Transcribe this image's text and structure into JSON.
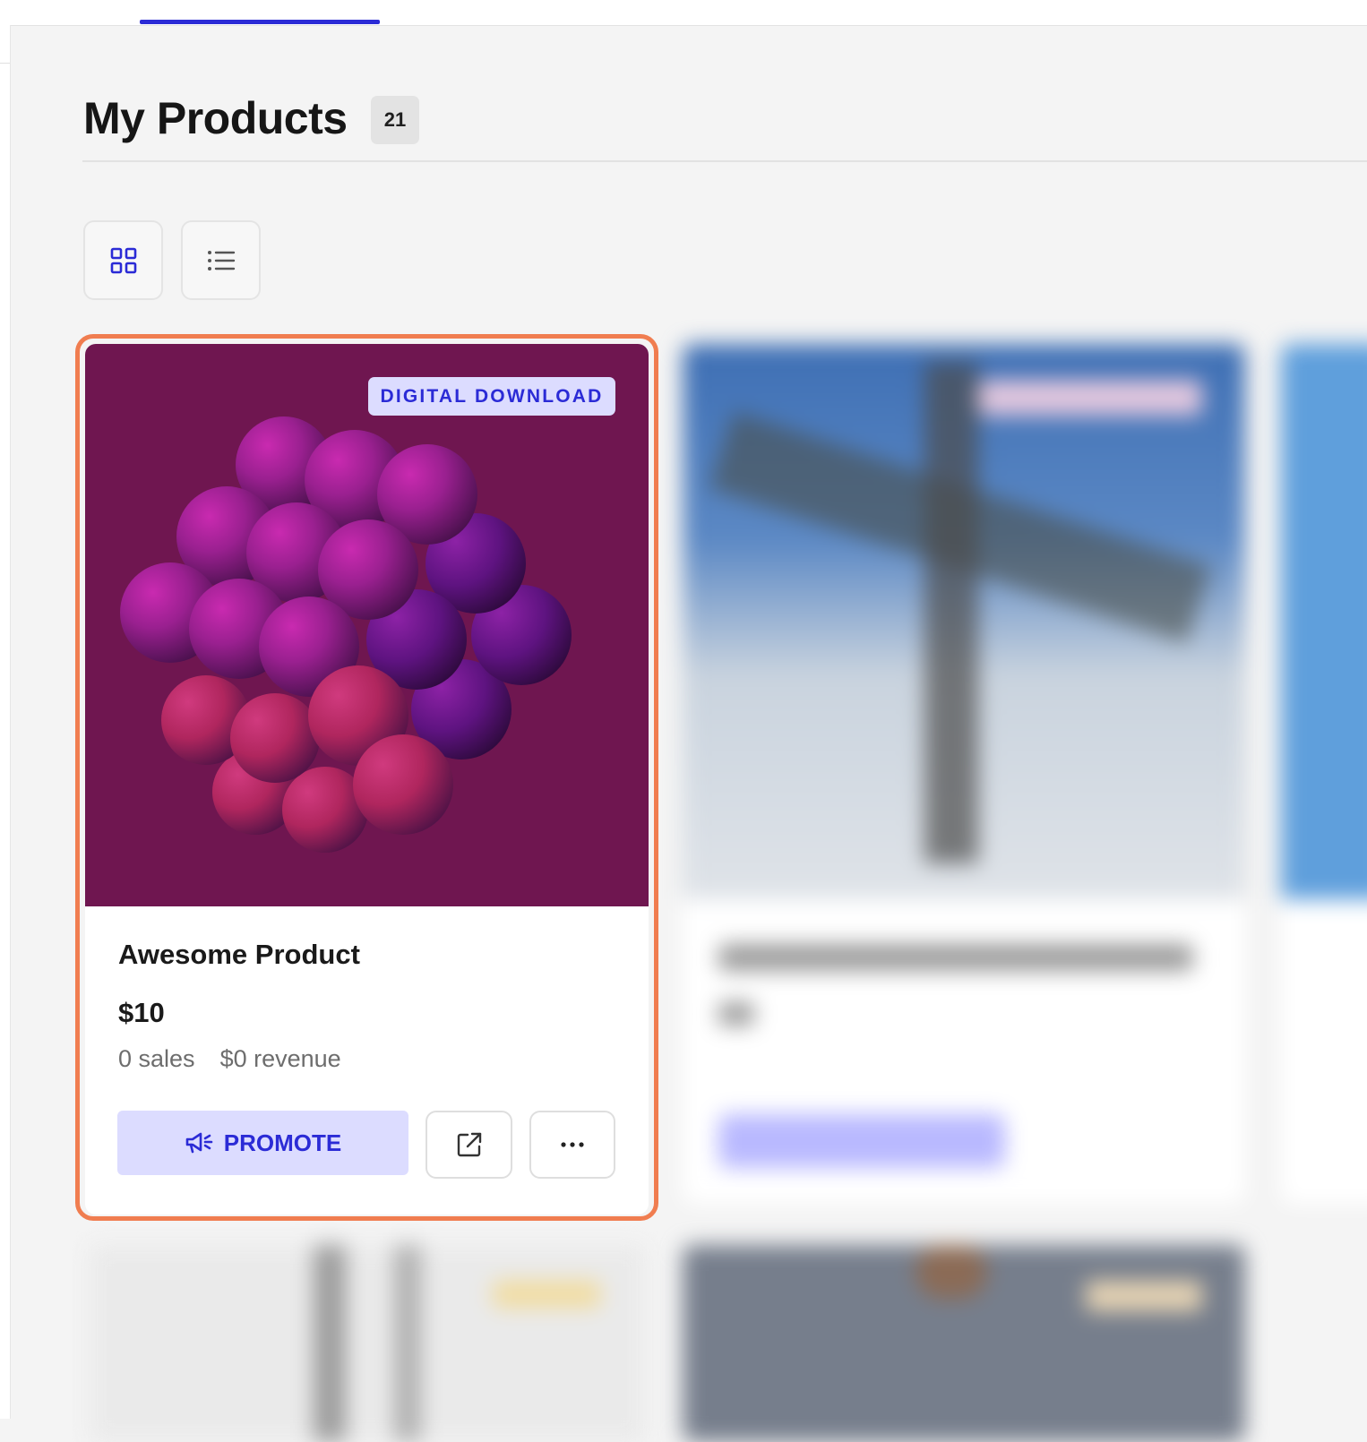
{
  "page": {
    "title": "My Products",
    "product_count": "21"
  },
  "view_toggle": {
    "grid_icon": "grid-icon",
    "list_icon": "list-icon",
    "selected": "grid"
  },
  "colors": {
    "accent": "#2b2bd6",
    "accent_soft": "#dcdcff",
    "highlight": "#f07d50",
    "card_image_bg": "#6f1650"
  },
  "featured_product": {
    "type_badge": "DIGITAL DOWNLOAD",
    "name": "Awesome Product",
    "price": "$10",
    "sales": "0 sales",
    "revenue": "$0 revenue",
    "promote_label": "PROMOTE",
    "promote_icon": "megaphone-icon",
    "open_icon": "external-link-icon",
    "more_icon": "more-icon"
  }
}
